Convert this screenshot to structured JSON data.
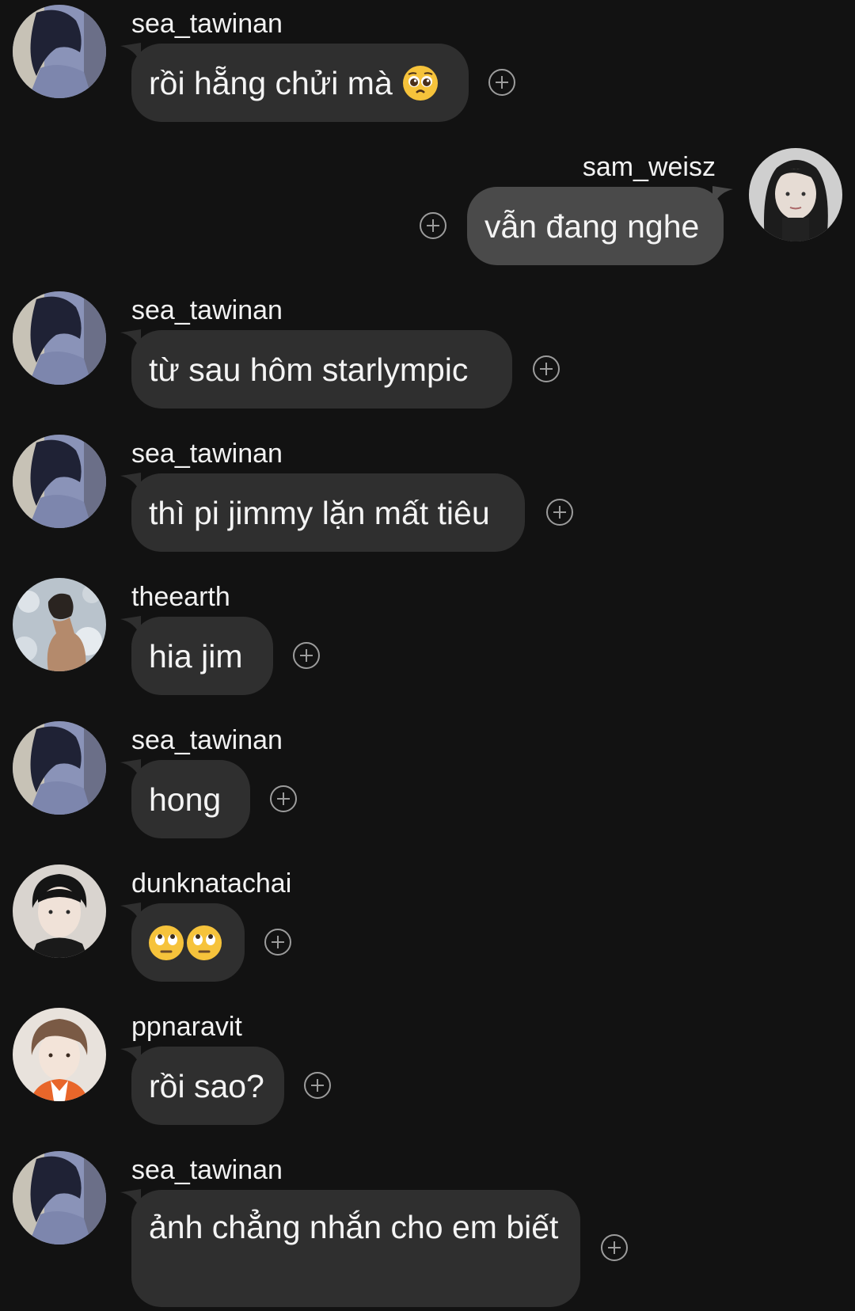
{
  "messages": [
    {
      "sender": "sea_tawinan",
      "text": "rồi hẵng chửi mà",
      "emoji": "pleading-face",
      "side": "left",
      "avatar": "avatar-sea"
    },
    {
      "sender": "sam_weisz",
      "text": "vẫn đang nghe",
      "side": "right",
      "avatar": "avatar-sam"
    },
    {
      "sender": "sea_tawinan",
      "text": "từ sau hôm starlympic",
      "side": "left",
      "avatar": "avatar-sea"
    },
    {
      "sender": "sea_tawinan",
      "text": "thì pi jimmy lặn mất tiêu",
      "side": "left",
      "avatar": "avatar-sea"
    },
    {
      "sender": "theearth",
      "text": "hia jim",
      "side": "left",
      "avatar": "avatar-earth"
    },
    {
      "sender": "sea_tawinan",
      "text": "hong",
      "side": "left",
      "avatar": "avatar-sea"
    },
    {
      "sender": "dunknatachai",
      "text": "",
      "emoji": "eye-roll-face-x2",
      "side": "left",
      "avatar": "avatar-dunk"
    },
    {
      "sender": "ppnaravit",
      "text": "rồi sao?",
      "side": "left",
      "avatar": "avatar-pp"
    },
    {
      "sender": "sea_tawinan",
      "text": "ảnh chẳng nhắn cho em biết",
      "side": "left",
      "avatar": "avatar-sea"
    }
  ],
  "icons": {
    "add_reaction": "add-reaction-icon",
    "pleading": "pleading-face-emoji",
    "eye_roll": "face-with-rolling-eyes-emoji"
  },
  "colors": {
    "background": "#121212",
    "bubble_incoming": "#2f2f2f",
    "bubble_outgoing": "#4a4a4a",
    "text": "#f4f4f4",
    "icon": "#9c9c9c"
  }
}
